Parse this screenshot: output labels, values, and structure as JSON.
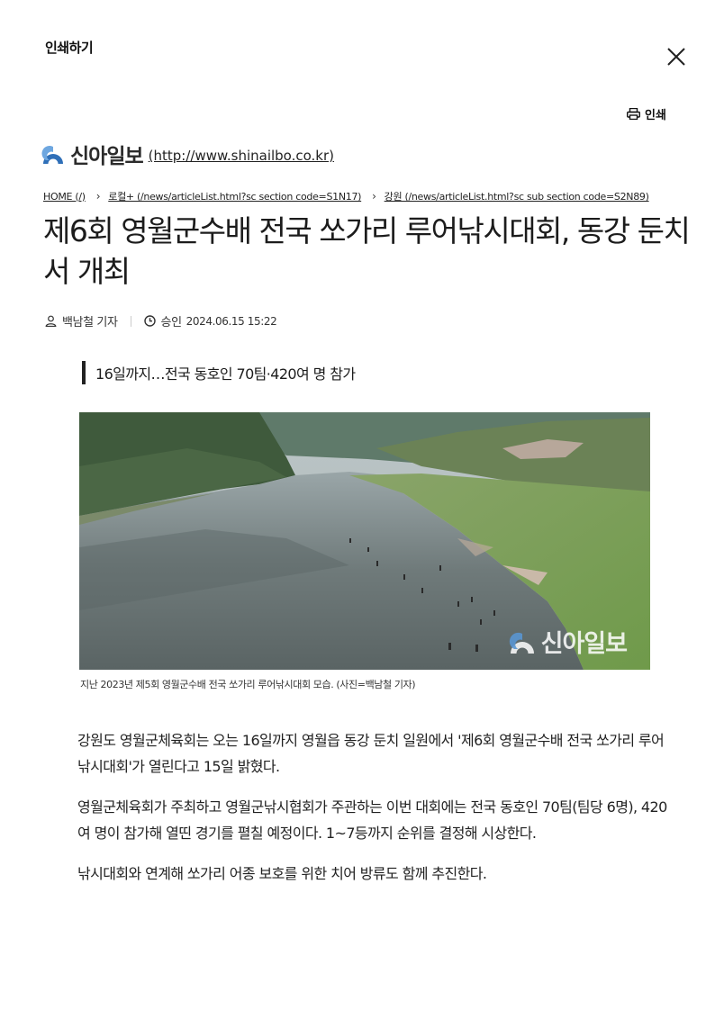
{
  "header": {
    "print_title": "인쇄하기",
    "print_label": "인쇄"
  },
  "masthead": {
    "logo_text": "신아일보",
    "url": "(http://www.shinailbo.co.kr)"
  },
  "breadcrumb": [
    {
      "label": "HOME (/)"
    },
    {
      "label": "로컬+ (/news/articleList.html?sc section code=S1N17)"
    },
    {
      "label": "강원 (/news/articleList.html?sc sub section code=S2N89)"
    }
  ],
  "article": {
    "title": "제6회 영월군수배 전국 쏘가리 루어낚시대회, 동강 둔치서 개최",
    "reporter": "백남철 기자",
    "approved_label": "승인",
    "datetime": "2024.06.15 15:22",
    "subhead": "16일까지…전국 동호인 70팀·420여 명 참가",
    "photo": {
      "watermark": "신아일보",
      "caption": "지난 2023년 제5회 영월군수배 전국 쏘가리 루어낚시대회 모습. (사진=백남철 기자)"
    },
    "paragraphs": [
      "강원도 영월군체육회는 오는 16일까지 영월읍 동강 둔치 일원에서 '제6회 영월군수배 전국 쏘가리 루어낚시대회'가 열린다고 15일 밝혔다.",
      "영월군체육회가 주최하고 영월군낚시협회가 주관하는 이번 대회에는 전국 동호인 70팀(팀당 6명), 420여 명이 참가해 열띤 경기를 펼칠 예정이다. 1~7등까지 순위를 결정해 시상한다.",
      "낚시대회와 연계해 쏘가리 어종 보호를 위한 치어 방류도 함께 추진한다."
    ]
  },
  "icons": {
    "close": "close-icon",
    "print": "printer-icon",
    "logo": "logo-mark-icon",
    "reporter": "person-icon",
    "time": "clock-icon"
  },
  "colors": {
    "logo_blue": "#2f6fb8",
    "text": "#1c1c1c"
  }
}
